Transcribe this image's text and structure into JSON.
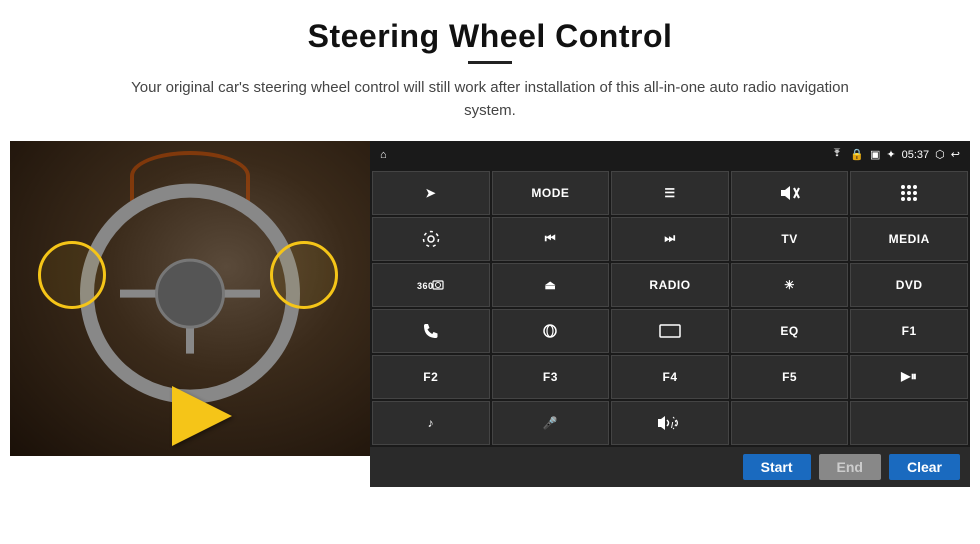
{
  "header": {
    "title": "Steering Wheel Control",
    "subtitle": "Your original car's steering wheel control will still work after installation of this all-in-one auto radio navigation system."
  },
  "statusBar": {
    "homeIcon": "⌂",
    "wifi": "wifi",
    "lock": "🔒",
    "sim": "sim",
    "bt": "bt",
    "time": "05:37",
    "cast": "cast",
    "back": "back"
  },
  "buttons": [
    {
      "id": "nav",
      "label": "➤",
      "type": "icon"
    },
    {
      "id": "mode",
      "label": "MODE",
      "type": "text"
    },
    {
      "id": "list",
      "label": "☰",
      "type": "icon"
    },
    {
      "id": "mute",
      "label": "🔇",
      "type": "icon"
    },
    {
      "id": "apps",
      "label": "⠿",
      "type": "icon"
    },
    {
      "id": "settings",
      "label": "⚙",
      "type": "icon"
    },
    {
      "id": "prev",
      "label": "⏮",
      "type": "icon"
    },
    {
      "id": "next",
      "label": "⏭",
      "type": "icon"
    },
    {
      "id": "tv",
      "label": "TV",
      "type": "text"
    },
    {
      "id": "media",
      "label": "MEDIA",
      "type": "text"
    },
    {
      "id": "cam360",
      "label": "360",
      "type": "icon"
    },
    {
      "id": "eject",
      "label": "⏏",
      "type": "icon"
    },
    {
      "id": "radio",
      "label": "RADIO",
      "type": "text"
    },
    {
      "id": "brightness",
      "label": "☀",
      "type": "icon"
    },
    {
      "id": "dvd",
      "label": "DVD",
      "type": "text"
    },
    {
      "id": "phone",
      "label": "📞",
      "type": "icon"
    },
    {
      "id": "swipe",
      "label": "⊝",
      "type": "icon"
    },
    {
      "id": "rect",
      "label": "▭",
      "type": "icon"
    },
    {
      "id": "eq",
      "label": "EQ",
      "type": "text"
    },
    {
      "id": "f1",
      "label": "F1",
      "type": "text"
    },
    {
      "id": "f2",
      "label": "F2",
      "type": "text"
    },
    {
      "id": "f3",
      "label": "F3",
      "type": "text"
    },
    {
      "id": "f4",
      "label": "F4",
      "type": "text"
    },
    {
      "id": "f5",
      "label": "F5",
      "type": "text"
    },
    {
      "id": "playpause",
      "label": "▶⏸",
      "type": "icon"
    },
    {
      "id": "music",
      "label": "♪",
      "type": "icon"
    },
    {
      "id": "mic",
      "label": "🎤",
      "type": "icon"
    },
    {
      "id": "volphone",
      "label": "🔊/📞",
      "type": "icon"
    }
  ],
  "bottomBar": {
    "startLabel": "Start",
    "endLabel": "End",
    "clearLabel": "Clear"
  }
}
